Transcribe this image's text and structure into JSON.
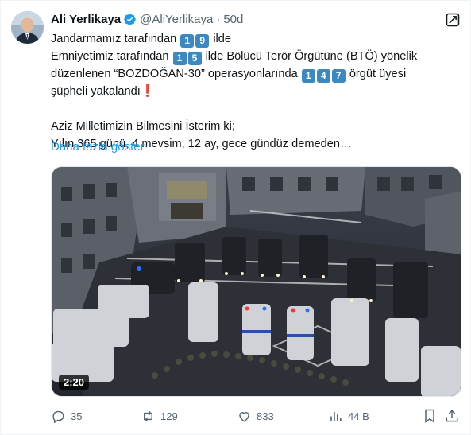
{
  "author": {
    "name": "Ali Yerlikaya",
    "handle": "@AliYerlikaya",
    "separator": "·",
    "time": "50d"
  },
  "post": {
    "l1_pre": "Jandarmamız tarafından",
    "l1_digits": [
      "1",
      "9"
    ],
    "l1_post": "ilde",
    "l2_pre": "Emniyetimiz tarafından",
    "l2_digits": [
      "1",
      "5"
    ],
    "l2_post": "ilde Bölücü Terör Örgütüne (BTÖ) yönelik",
    "l3_pre": "düzenlenen “BOZDOĞAN-30” operasyonlarında",
    "l3_digits": [
      "1",
      "4",
      "7"
    ],
    "l3_post": "örgüt üyesi",
    "l4": "şüpheli yakalandı",
    "l4_mark": "❗",
    "l5": "Aziz Milletimizin Bilmesini İsterim ki;",
    "l6": "Yılın 365 günü, 4 mevsim, 12 ay, gece gündüz demeden…",
    "show_more": "Daha fazla göster"
  },
  "media": {
    "duration": "2:20"
  },
  "actions": {
    "replies": "35",
    "reposts": "129",
    "likes": "833",
    "views": "44 B"
  },
  "colors": {
    "link": "#1d9bf0",
    "muted": "#536471",
    "verified": "#1d9bf0",
    "keycap": "#3b88c3"
  }
}
